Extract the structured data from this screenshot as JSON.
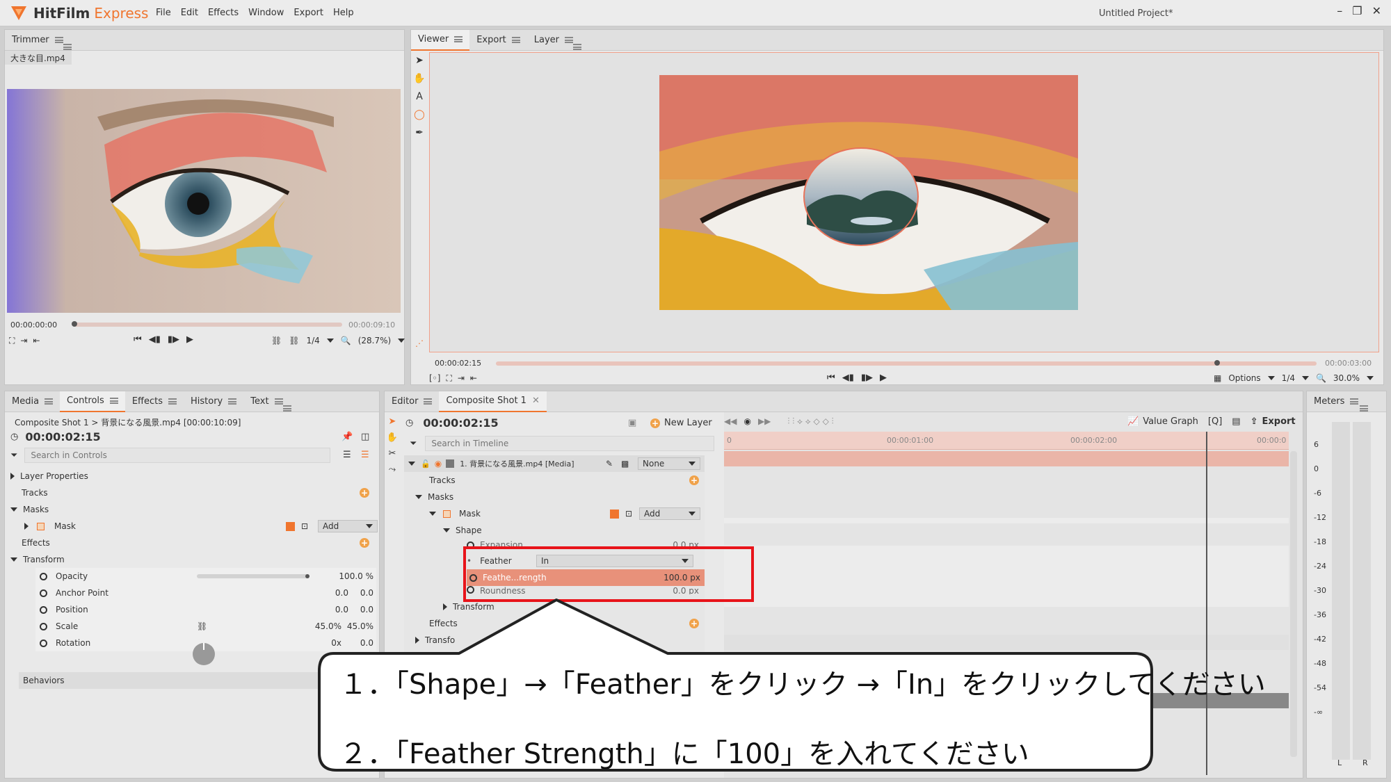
{
  "app": {
    "brand": "HitFilm",
    "brand2": "Express",
    "project_title": "Untitled Project*"
  },
  "menu": [
    "File",
    "Edit",
    "Effects",
    "Window",
    "Export",
    "Help"
  ],
  "trimmer": {
    "tab": "Trimmer",
    "file_tab": "大きな目.mp4",
    "time_start": "00:00:00:00",
    "time_end": "00:00:09:10",
    "res": "1/4",
    "zoom": "(28.7%)"
  },
  "viewer": {
    "tabs": [
      "Viewer",
      "Export",
      "Layer"
    ],
    "time_current": "00:00:02:15",
    "time_end": "00:00:03:00",
    "options": "Options",
    "res": "1/4",
    "zoom": "30.0%"
  },
  "controls_panel": {
    "tabs": [
      "Media",
      "Controls",
      "Effects",
      "History",
      "Text"
    ],
    "breadcrumb": "Composite Shot 1 > 背景になる風景.mp4 [00:00:10:09]",
    "time": "00:00:02:15",
    "search_placeholder": "Search in Controls",
    "rows": {
      "layer_properties": "Layer Properties",
      "tracks": "Tracks",
      "masks": "Masks",
      "mask": "Mask",
      "mask_mode": "Add",
      "effects": "Effects",
      "transform": "Transform",
      "opacity": "Opacity",
      "opacity_val": "100.0 %",
      "anchor": "Anchor Point",
      "anchor_x": "0.0",
      "anchor_y": "0.0",
      "position": "Position",
      "position_x": "0.0",
      "position_y": "0.0",
      "scale": "Scale",
      "scale_x": "45.0%",
      "scale_y": "45.0%",
      "rotation": "Rotation",
      "rotation_turns": "0x",
      "rotation_deg": "0.0",
      "behaviors": "Behaviors"
    }
  },
  "editor": {
    "tabs": [
      "Editor",
      "Composite Shot 1"
    ],
    "time": "00:00:02:15",
    "new_layer": "New Layer",
    "value_graph": "Value Graph",
    "export": "Export",
    "search_placeholder": "Search in Timeline",
    "ruler": [
      "0",
      "00:00:01:00",
      "00:00:02:00",
      "00:00:0"
    ],
    "rows": {
      "layer": "1. 背景になる風景.mp4 [Media]",
      "blend": "None",
      "tracks": "Tracks",
      "masks": "Masks",
      "mask": "Mask",
      "mask_mode": "Add",
      "shape": "Shape",
      "expansion": "Expansion",
      "expansion_val": "0.0 px",
      "feather": "Feather",
      "feather_val": "In",
      "feather_strength": "Feathe...rength",
      "feather_strength_val": "100.0 px",
      "roundness": "Roundness",
      "roundness_val": "0.0 px",
      "transform": "Transform",
      "effects": "Effects",
      "transform2": "Transfo"
    }
  },
  "meters": {
    "tab": "Meters",
    "ticks": [
      "6",
      "0",
      "-6",
      "-12",
      "-18",
      "-24",
      "-30",
      "-36",
      "-42",
      "-48",
      "-54",
      "-∞"
    ],
    "l": "L",
    "r": "R"
  },
  "callout": {
    "line1": "１．「Shape」→「Feather」をクリック →「In」をクリックしてください",
    "line2": "２．「Feather Strength」に「100」を入れてください"
  },
  "colors": {
    "accent": "#f0752e",
    "highlight_row": "#e8917a",
    "annotation_red": "#e8141a"
  }
}
